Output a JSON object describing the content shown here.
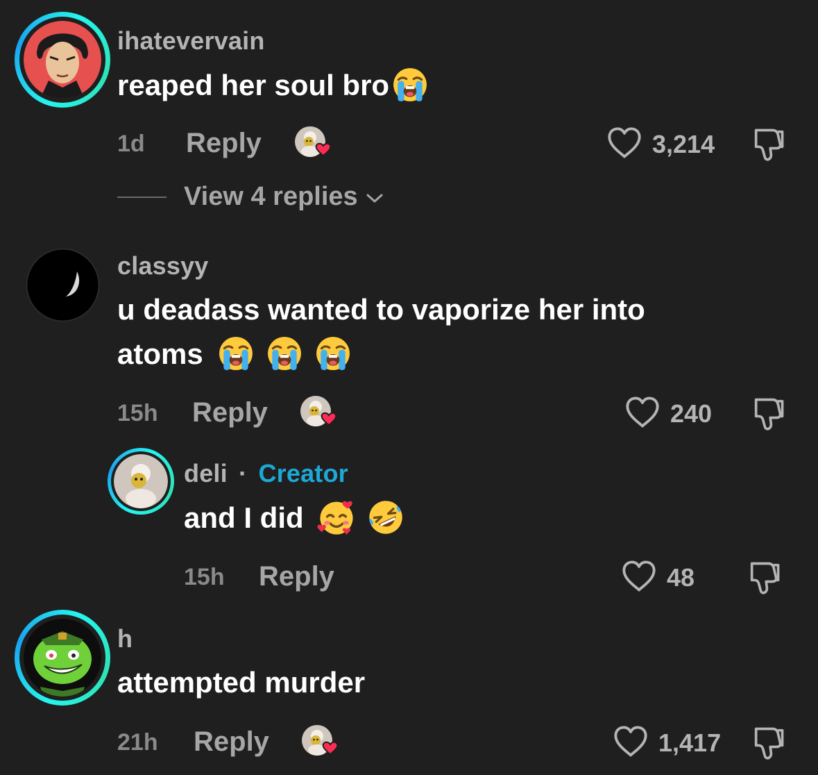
{
  "comments": [
    {
      "username": "ihatevervain",
      "text": "reaped her soul bro",
      "time": "1d",
      "reply_label": "Reply",
      "likes": "3,214",
      "view_replies": "View 4 replies"
    },
    {
      "username": "classyy",
      "text_line1": "u deadass wanted to vaporize her into",
      "text_line2": "atoms",
      "time": "15h",
      "reply_label": "Reply",
      "likes": "240"
    },
    {
      "username": "deli",
      "separator": "·",
      "badge": "Creator",
      "text": "and I did",
      "time": "15h",
      "reply_label": "Reply",
      "likes": "48"
    },
    {
      "username": "h",
      "text": "attempted murder",
      "time": "21h",
      "reply_label": "Reply",
      "likes": "1,417"
    }
  ],
  "icons": {
    "like": "heart-outline-icon",
    "dislike": "thumbs-down-icon",
    "creator_liked": "creator-liked-heart-badge",
    "crying": "loudly-crying-face-emoji",
    "hearts_face": "smiling-face-with-hearts-emoji",
    "rofl": "rolling-on-floor-laughing-emoji"
  },
  "colors": {
    "background": "#1f1f1f",
    "ring": "#25f4ee",
    "creator": "#1ca9d6",
    "heart_badge": "#fe2c55"
  }
}
